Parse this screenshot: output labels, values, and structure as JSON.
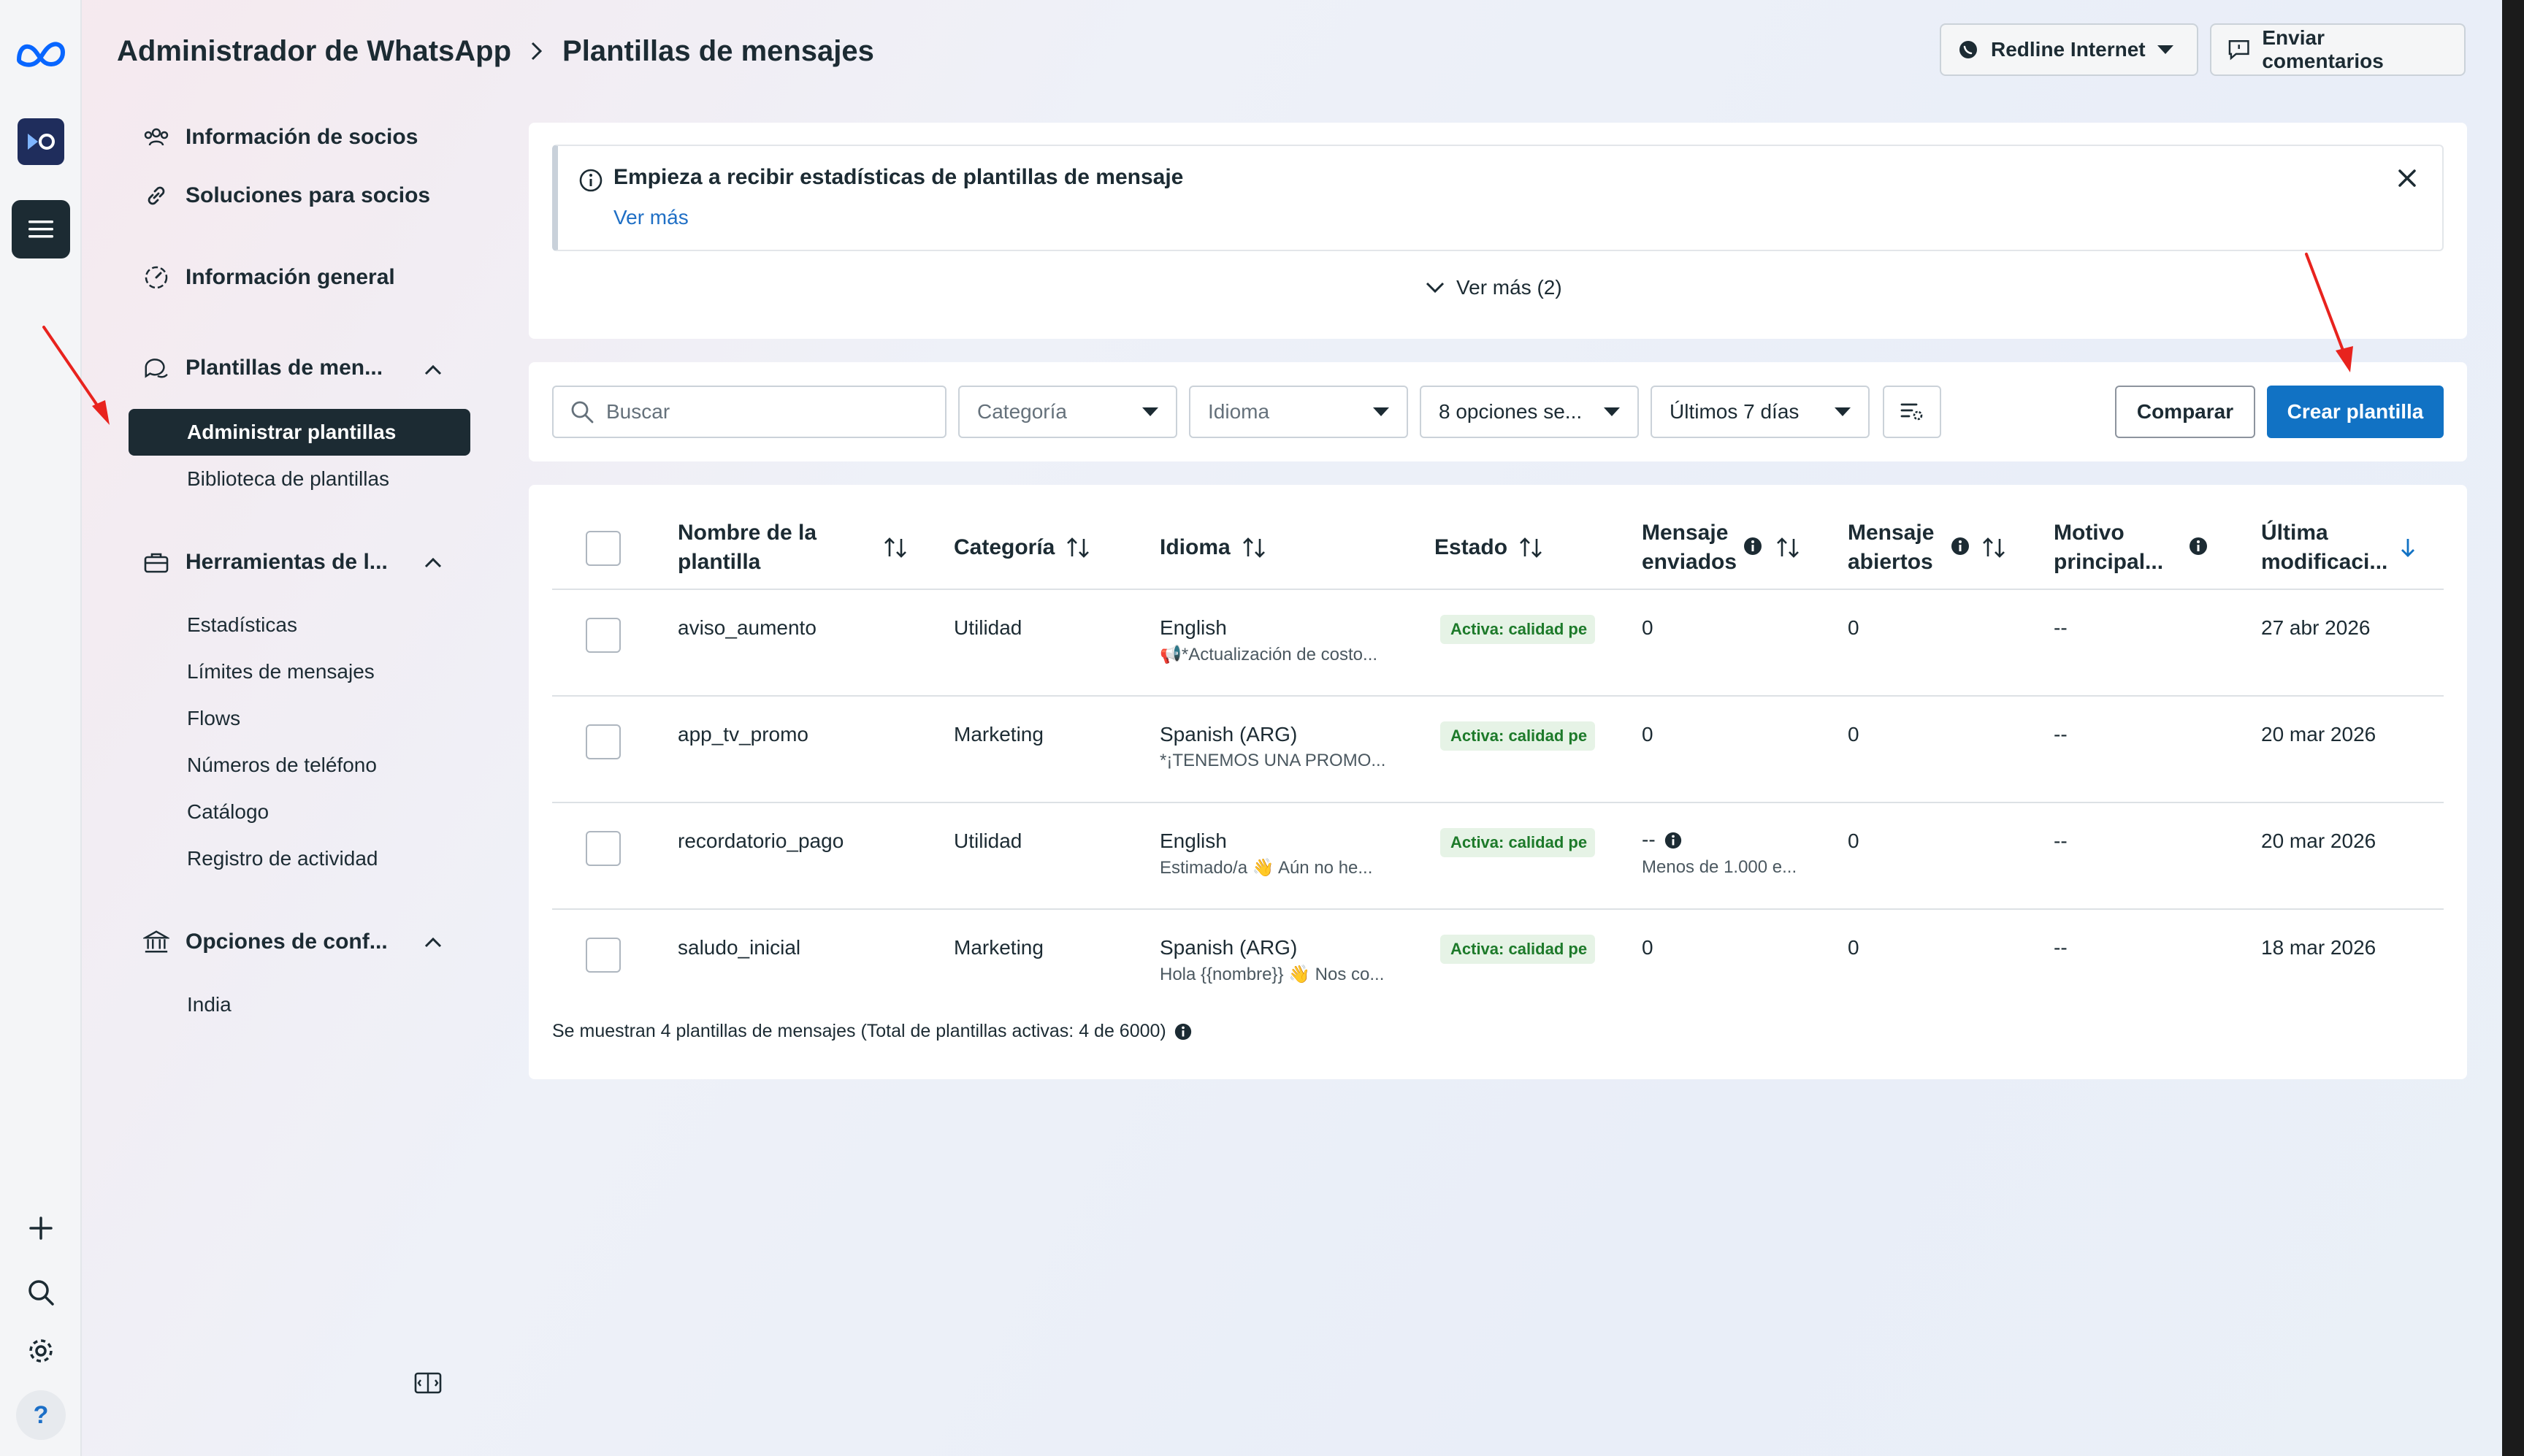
{
  "header": {
    "app_title": "Administrador de WhatsApp",
    "page_title": "Plantillas de mensajes",
    "account_label": "Redline Internet",
    "feedback_label": "Enviar comentarios"
  },
  "sidebar": {
    "items": [
      {
        "label": "Información de socios",
        "icon": "users-icon"
      },
      {
        "label": "Soluciones para socios",
        "icon": "link-icon"
      },
      {
        "label": "Información general",
        "icon": "dashboard-icon"
      }
    ],
    "sections": [
      {
        "label": "Plantillas de men...",
        "icon": "chat-bubbles-icon",
        "children": [
          "Administrar plantillas",
          "Biblioteca de plantillas"
        ]
      },
      {
        "label": "Herramientas de l...",
        "icon": "briefcase-icon",
        "children": [
          "Estadísticas",
          "Límites de mensajes",
          "Flows",
          "Números de teléfono",
          "Catálogo",
          "Registro de actividad"
        ]
      },
      {
        "label": "Opciones de conf...",
        "icon": "bank-icon",
        "children": [
          "India"
        ]
      }
    ]
  },
  "banner": {
    "title": "Empieza a recibir estadísticas de plantillas de mensaje",
    "link": "Ver más",
    "expand_label": "Ver más (2)"
  },
  "toolbar": {
    "search_placeholder": "Buscar",
    "category_placeholder": "Categoría",
    "language_placeholder": "Idioma",
    "status_filter": "8 opciones se...",
    "date_filter": "Últimos 7 días",
    "compare_label": "Comparar",
    "create_label": "Crear plantilla"
  },
  "table": {
    "headers": {
      "name_1": "Nombre de la",
      "name_2": "plantilla",
      "category": "Categoría",
      "language": "Idioma",
      "status": "Estado",
      "sent_1": "Mensaje",
      "sent_2": "enviados",
      "opened_1": "Mensaje",
      "opened_2": "abiertos",
      "reason_1": "Motivo",
      "reason_2": "principal...",
      "modified_1": "Última",
      "modified_2": "modificaci..."
    },
    "rows": [
      {
        "name": "aviso_aumento",
        "category": "Utilidad",
        "language": "English",
        "preview": "📢*Actualización de costo...",
        "status": "Activa: calidad pe",
        "sent": "0",
        "sent_sub": "",
        "opened": "0",
        "reason": "--",
        "modified": "27 abr 2026"
      },
      {
        "name": "app_tv_promo",
        "category": "Marketing",
        "language": "Spanish (ARG)",
        "preview": "*¡TENEMOS UNA PROMO...",
        "status": "Activa: calidad pe",
        "sent": "0",
        "sent_sub": "",
        "opened": "0",
        "reason": "--",
        "modified": "20 mar 2026"
      },
      {
        "name": "recordatorio_pago",
        "category": "Utilidad",
        "language": "English",
        "preview": "Estimado/a 👋 Aún no he...",
        "status": "Activa: calidad pe",
        "sent": "--",
        "sent_sub": "Menos de 1.000 e...",
        "opened": "0",
        "reason": "--",
        "modified": "20 mar 2026"
      },
      {
        "name": "saludo_inicial",
        "category": "Marketing",
        "language": "Spanish (ARG)",
        "preview": "Hola {{nombre}} 👋 Nos co...",
        "status": "Activa: calidad pe",
        "sent": "0",
        "sent_sub": "",
        "opened": "0",
        "reason": "--",
        "modified": "18 mar 2026"
      }
    ],
    "footer": "Se muestran 4 plantillas de mensajes (Total de plantillas activas: 4 de 6000)"
  },
  "colors": {
    "primary": "#1172c4",
    "dark": "#1c2b33",
    "badge_bg": "#e6f3e6",
    "badge_text": "#1d7a2a",
    "annotation": "#e8231e"
  }
}
